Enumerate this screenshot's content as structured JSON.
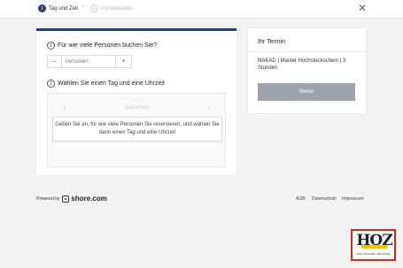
{
  "steps": [
    {
      "number": "1",
      "label": "Tag und Zeit"
    },
    {
      "number": "2",
      "label": "Kontaktdaten"
    }
  ],
  "step_separator": ">",
  "close_glyph": "✕",
  "booking": {
    "question1": {
      "number": "1",
      "text": "Für wie viele Personen buchen Sie?"
    },
    "minus": "–",
    "plus": "+",
    "persons_placeholder": "Personen",
    "question2": {
      "number": "2",
      "text": "Wählen Sie einen Tag und eine Uhrzeit"
    },
    "month": "September",
    "prev_arrow": "‹",
    "next_arrow": "›",
    "info": "Geben Sie an, für wie viele Personen Sie reservieren, und wählen Sie dann einen Tag und eine Uhrzeit"
  },
  "sidebar": {
    "title": "Ihr Termin",
    "service": "NAKAD | Master Hochsteckschein | 3 Stunden",
    "button": "Weiter"
  },
  "footer": {
    "powered_by": "Powered by",
    "brand": "shore.com",
    "links": [
      "AGB",
      "Datenschutz",
      "Impressum"
    ]
  },
  "logo": {
    "text": "HOZ",
    "subtitle": "DAS HOCHZEIT ZENTRUM"
  },
  "colors": {
    "accent": "#2c3e6b",
    "button": "#9aa2ab",
    "logo_border": "#d9251c",
    "logo_swoosh": "#f2c500"
  }
}
